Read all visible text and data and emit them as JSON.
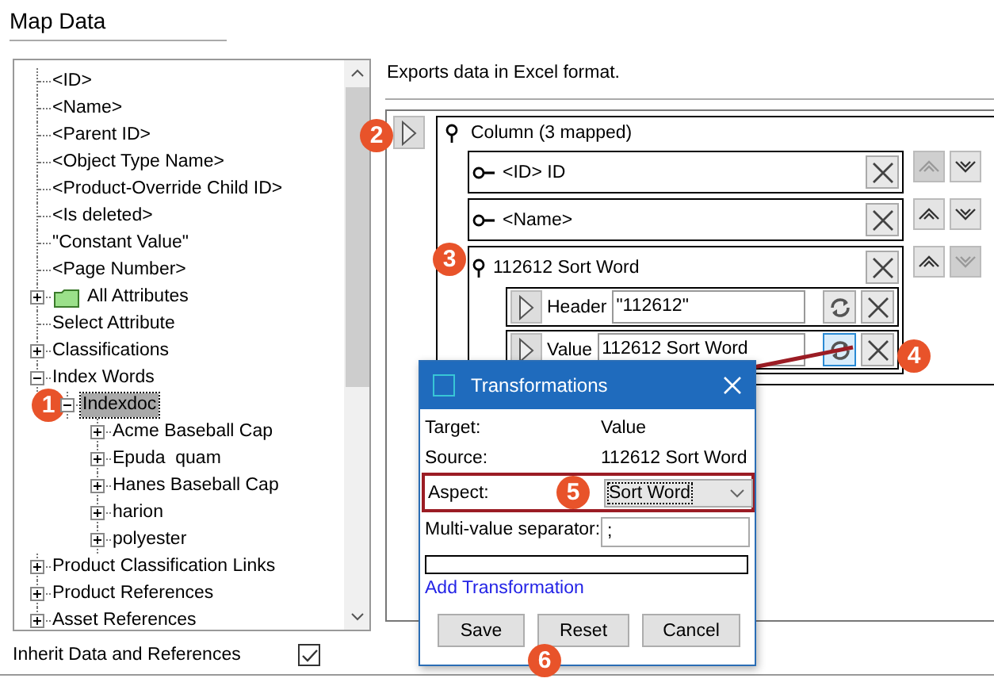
{
  "title": "Map Data",
  "tree": {
    "items": [
      {
        "label": "<ID>",
        "selected": false
      },
      {
        "label": "<Name>",
        "selected": false
      },
      {
        "label": "<Parent ID>",
        "selected": false
      },
      {
        "label": "<Object Type Name>",
        "selected": false
      },
      {
        "label": "<Product-Override Child ID>",
        "selected": false
      },
      {
        "label": "<Is deleted>",
        "selected": false
      },
      {
        "label": "\"Constant Value\"",
        "selected": false
      },
      {
        "label": "<Page Number>",
        "selected": false
      },
      {
        "label": "All Attributes",
        "kind": "folder",
        "expanded": false,
        "selected": false
      },
      {
        "label": "Select Attribute",
        "selected": false
      },
      {
        "label": "Classifications",
        "expanded": false,
        "selected": false
      },
      {
        "label": "Index Words",
        "expanded": true,
        "selected": false,
        "children": [
          {
            "label": "Indexdoc",
            "expanded": true,
            "selected": true,
            "children": [
              {
                "label": "Acme Baseball Cap",
                "expanded": false,
                "selected": false
              },
              {
                "label": "Epuda  quam",
                "expanded": false,
                "selected": false
              },
              {
                "label": "Hanes Baseball Cap",
                "expanded": false,
                "selected": false
              },
              {
                "label": "harion",
                "expanded": false,
                "selected": false
              },
              {
                "label": "polyester",
                "expanded": false,
                "selected": false
              }
            ]
          }
        ]
      },
      {
        "label": "Product Classification Links",
        "expanded": false,
        "selected": false
      },
      {
        "label": "Product References",
        "expanded": false,
        "selected": false
      },
      {
        "label": "Asset References",
        "expanded": false,
        "selected": false
      }
    ]
  },
  "inherit": {
    "label": "Inherit Data and References",
    "checked": true
  },
  "description": "Exports data in Excel format.",
  "mapping": {
    "label": "Column (3 mapped)",
    "rows": [
      {
        "kind": "attribute",
        "label": "<ID> ID",
        "up_disabled": true,
        "down_disabled": false
      },
      {
        "kind": "attribute",
        "label": "<Name>",
        "up_disabled": false,
        "down_disabled": false
      },
      {
        "kind": "group",
        "label": "112612 Sort Word",
        "up_disabled": false,
        "down_disabled": true,
        "fields": [
          {
            "label": "Header",
            "value": "\"112612\"",
            "selected": false
          },
          {
            "label": "Value",
            "value": "112612 Sort Word",
            "selected": true
          }
        ]
      }
    ]
  },
  "dialog": {
    "title": "Transformations",
    "rows": [
      {
        "kind": "text",
        "label": "Target:",
        "value": "Value"
      },
      {
        "kind": "text",
        "label": "Source:",
        "value": "112612 Sort Word"
      },
      {
        "kind": "select",
        "label": "Aspect:",
        "value": "Sort Word",
        "highlighted": true
      },
      {
        "kind": "input",
        "label": "Multi-value separator:",
        "value": ";"
      }
    ],
    "link": "Add Transformation",
    "buttons": [
      "Save",
      "Reset",
      "Cancel"
    ]
  },
  "callouts": [
    {
      "label": "1"
    },
    {
      "label": "2"
    },
    {
      "label": "3"
    },
    {
      "label": "4"
    },
    {
      "label": "5"
    },
    {
      "label": "6"
    }
  ]
}
